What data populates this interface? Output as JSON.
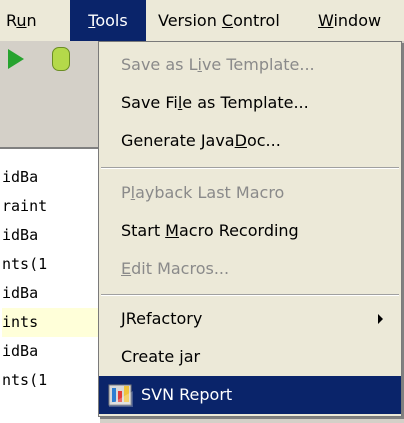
{
  "menubar": {
    "items": [
      {
        "pre": "R",
        "mnem": "u",
        "post": "n"
      },
      {
        "pre": "",
        "mnem": "T",
        "post": "ools"
      },
      {
        "pre": "Version ",
        "mnem": "C",
        "post": "ontrol"
      },
      {
        "pre": "",
        "mnem": "W",
        "post": "indow"
      }
    ]
  },
  "toolbar": {
    "run_icon": "play-icon",
    "debug_icon": "bug-icon"
  },
  "code": {
    "lines": [
      "idBa",
      "raint",
      "idBa",
      "nts(1",
      "idBa",
      "ints",
      "idBa",
      "nts(1"
    ]
  },
  "tools_menu": {
    "items": [
      {
        "pre": "Save as L",
        "mnem": "i",
        "post": "ve Template...",
        "enabled": false
      },
      {
        "pre": "Save Fi",
        "mnem": "l",
        "post": "e as Template...",
        "enabled": true
      },
      {
        "pre": "Generate Java",
        "mnem": "D",
        "post": "oc...",
        "enabled": true
      },
      {
        "pre": "P",
        "mnem": "l",
        "post": "ayback Last Macro",
        "enabled": false
      },
      {
        "pre": "Start ",
        "mnem": "M",
        "post": "acro Recording",
        "enabled": true
      },
      {
        "pre": "",
        "mnem": "E",
        "post": "dit Macros...",
        "enabled": false
      },
      {
        "pre": "JRefactory",
        "mnem": "",
        "post": "",
        "enabled": true,
        "submenu": true
      },
      {
        "pre": "Create jar",
        "mnem": "",
        "post": "",
        "enabled": true
      },
      {
        "pre": "SVN Report",
        "mnem": "",
        "post": "",
        "enabled": true,
        "selected": true,
        "icon": "svn-icon"
      }
    ]
  },
  "colors": {
    "selection": "#0a246a",
    "menu_bg": "#ece9d8",
    "disabled_text": "#8a8a8a"
  }
}
